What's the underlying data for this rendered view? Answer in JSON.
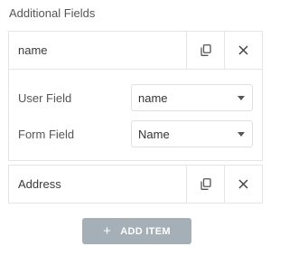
{
  "section": {
    "title": "Additional Fields"
  },
  "items": [
    {
      "title": "name",
      "fields": [
        {
          "label": "User Field",
          "value": "name"
        },
        {
          "label": "Form Field",
          "value": "Name"
        }
      ]
    },
    {
      "title": "Address"
    }
  ],
  "icons": {
    "duplicate": "copy-icon",
    "remove": "close-icon",
    "dropdown": "chevron-down-icon",
    "add": "plus-icon"
  },
  "add_button": {
    "plus": "+",
    "label": "ADD ITEM"
  },
  "colors": {
    "border": "#e4e5e7",
    "add_button_bg": "#a4afb7"
  }
}
